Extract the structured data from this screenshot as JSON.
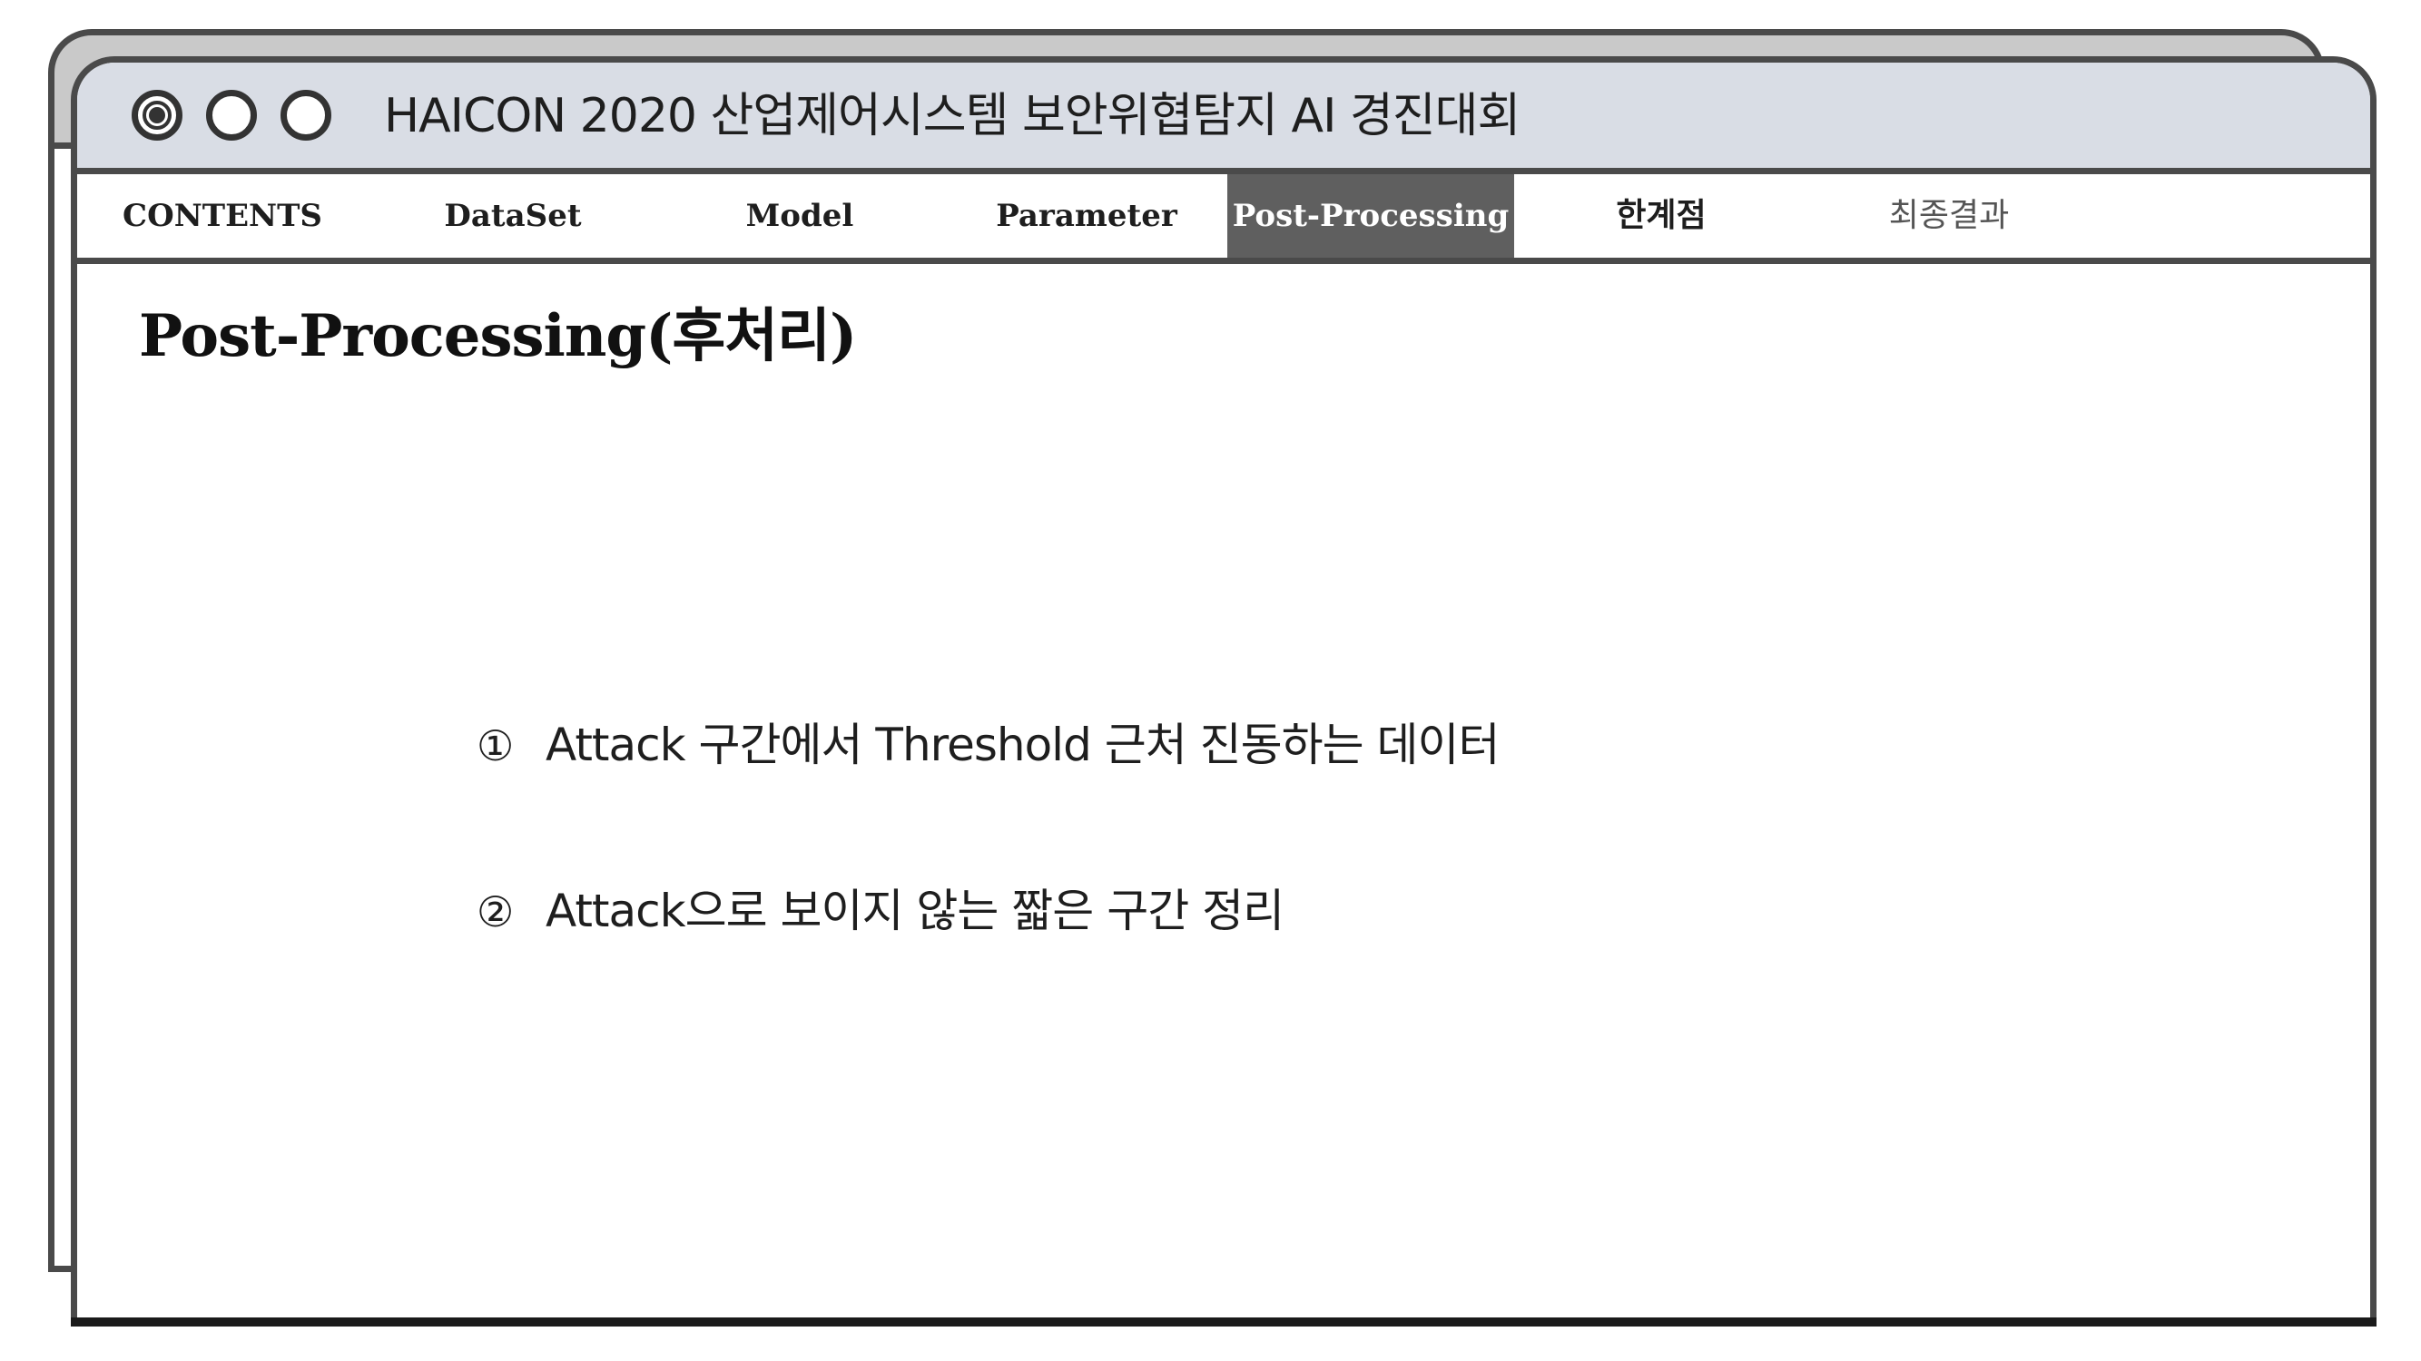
{
  "window": {
    "title": "HAICON 2020 산업제어시스템 보안위협탐지 AI 경진대회"
  },
  "nav": {
    "items": [
      {
        "label": "CONTENTS"
      },
      {
        "label": "DataSet"
      },
      {
        "label": "Model"
      },
      {
        "label": "Parameter"
      },
      {
        "label": "Post-Processing"
      },
      {
        "label": "한계점"
      },
      {
        "label": "최종결과"
      }
    ],
    "active": "Post-Processing"
  },
  "main": {
    "title": "Post-Processing(후처리)",
    "points": [
      {
        "num": "①",
        "text": "Attack 구간에서 Threshold 근처 진동하는 데이터"
      },
      {
        "num": "②",
        "text": "Attack으로 보이지 않는 짧은 구간 정리"
      }
    ]
  },
  "colors": {
    "titlebar": "#d9dde5",
    "border": "#4a4a4a",
    "active_tab": "#5f5f5f",
    "back_window": "#c9c9c9"
  },
  "icons": [
    "window-control-active-icon",
    "window-control-icon",
    "window-control-icon"
  ]
}
